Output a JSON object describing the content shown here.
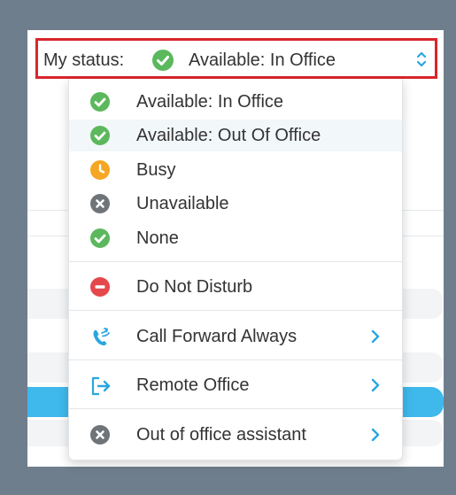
{
  "status_bar": {
    "label": "My status:",
    "value": "Available: In Office",
    "icon": "check-circle-icon"
  },
  "menu": {
    "items": [
      {
        "label": "Available: In Office",
        "icon": "check-circle-icon",
        "color": "#5cb85c"
      },
      {
        "label": "Available: Out Of Office",
        "icon": "check-circle-icon",
        "color": "#5cb85c",
        "highlighted": true
      },
      {
        "label": "Busy",
        "icon": "clock-icon",
        "color": "#f5a623"
      },
      {
        "label": "Unavailable",
        "icon": "x-circle-icon",
        "color": "#6f7478"
      },
      {
        "label": "None",
        "icon": "check-circle-icon",
        "color": "#5cb85c"
      },
      {
        "label": "Do Not Disturb",
        "icon": "minus-circle-icon",
        "color": "#e4484b"
      },
      {
        "label": "Call Forward Always",
        "icon": "phone-forward-icon",
        "color": "#2aa6e0",
        "submenu": true
      },
      {
        "label": "Remote Office",
        "icon": "sign-out-icon",
        "color": "#2aa6e0",
        "submenu": true
      },
      {
        "label": "Out of office assistant",
        "icon": "x-circle-icon",
        "color": "#6f7478",
        "submenu": true
      }
    ]
  },
  "colors": {
    "highlight_border": "#d8262c",
    "accent_blue": "#2aa6e0",
    "green": "#5cb85c"
  }
}
